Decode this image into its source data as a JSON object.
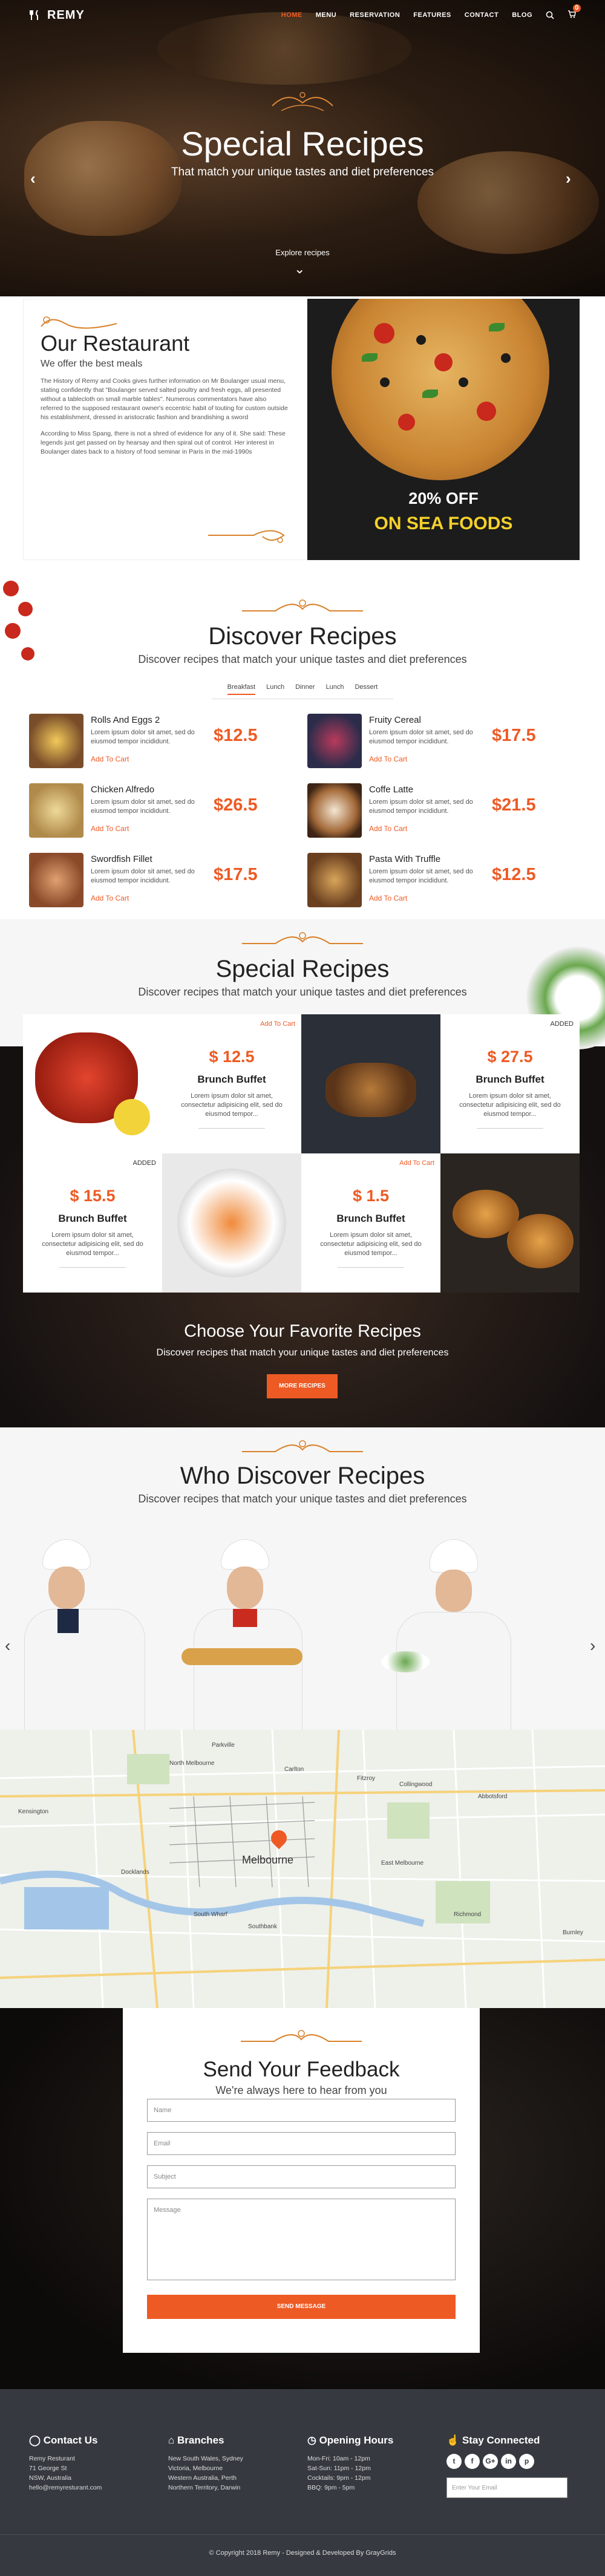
{
  "brand": "REMY",
  "nav": [
    "HOME",
    "MENU",
    "RESERVATION",
    "FEATURES",
    "CONTACT",
    "BLOG"
  ],
  "cart_count": "0",
  "accent": "#ee5a24",
  "hero": {
    "title": "Special Recipes",
    "subtitle": "That match your unique tastes and diet preferences",
    "explore": "Explore recipes"
  },
  "restaurant": {
    "title": "Our Restaurant",
    "subtitle": "We offer the best meals",
    "p1": "The History of Remy and Cooks gives further information on Mr Boulanger usual menu, stating confidently that \"Boulanger served salted poultry and fresh eggs, all presented without a tablecloth on small marble tables\". Numerous commentators have also referred to the supposed restaurant owner's eccentric habit of touting for custom outside his establishment, dressed in aristocratic fashion and brandishing a sword",
    "p2": "According to Miss Spang, there is not a shred of evidence for any of it. She said: These legends just get passed on by hearsay and then spiral out of control. Her interest in Boulanger dates back to a history of food seminar in Paris in the mid-1990s",
    "offer1": "20% OFF",
    "offer2": "ON SEA FOODS"
  },
  "discover": {
    "title": "Discover Recipes",
    "subtitle": "Discover recipes that match your unique tastes and diet preferences",
    "tabs": [
      "Breakfast",
      "Lunch",
      "Dinner",
      "Lunch",
      "Dessert"
    ],
    "items": [
      {
        "name": "Rolls And Eggs 2",
        "desc": "Lorem ipsum dolor sit amet, sed do eiusmod tempor incididunt.",
        "price": "$12.5",
        "cart": "Add To Cart"
      },
      {
        "name": "Fruity Cereal",
        "desc": "Lorem ipsum dolor sit amet, sed do eiusmod tempor incididunt.",
        "price": "$17.5",
        "cart": "Add To Cart"
      },
      {
        "name": "Chicken Alfredo",
        "desc": "Lorem ipsum dolor sit amet, sed do eiusmod tempor incididunt.",
        "price": "$26.5",
        "cart": "Add To Cart"
      },
      {
        "name": "Coffe Latte",
        "desc": "Lorem ipsum dolor sit amet, sed do eiusmod tempor incididunt.",
        "price": "$21.5",
        "cart": "Add To Cart"
      },
      {
        "name": "Swordfish Fillet",
        "desc": "Lorem ipsum dolor sit amet, sed do eiusmod tempor incididunt.",
        "price": "$17.5",
        "cart": "Add To Cart"
      },
      {
        "name": "Pasta With Truffle",
        "desc": "Lorem ipsum dolor sit amet, sed do eiusmod tempor incididunt.",
        "price": "$12.5",
        "cart": "Add To Cart"
      }
    ]
  },
  "special": {
    "title": "Special Recipes",
    "subtitle": "Discover recipes that match your unique tastes and diet preferences",
    "cards": [
      {
        "tag": "Add To Cart",
        "price": "$ 12.5",
        "name": "Brunch Buffet",
        "desc": "Lorem ipsum dolor sit amet, consectetur adipisicing elit, sed do eiusmod tempor..."
      },
      {
        "tag": "ADDED",
        "price": "$ 27.5",
        "name": "Brunch Buffet",
        "desc": "Lorem ipsum dolor sit amet, consectetur adipisicing elit, sed do eiusmod tempor..."
      },
      {
        "tag": "ADDED",
        "price": "$ 15.5",
        "name": "Brunch Buffet",
        "desc": "Lorem ipsum dolor sit amet, consectetur adipisicing elit, sed do eiusmod tempor..."
      },
      {
        "tag": "Add To Cart",
        "price": "$ 1.5",
        "name": "Brunch Buffet",
        "desc": "Lorem ipsum dolor sit amet, consectetur adipisicing elit, sed do eiusmod tempor..."
      }
    ],
    "choose_title": "Choose Your Favorite Recipes",
    "choose_sub": "Discover recipes that match your unique tastes and diet preferences",
    "more_btn": "MORE RECIPES"
  },
  "chefs": {
    "title": "Who Discover Recipes",
    "subtitle": "Discover recipes that match your unique tastes and diet preferences"
  },
  "map": {
    "city": "Melbourne",
    "labels": [
      "North Melbourne",
      "Carlton",
      "Fitzroy",
      "Collingwood",
      "Abbotsford",
      "Richmond",
      "Docklands",
      "South Wharf",
      "East Melbourne",
      "Burnley",
      "Kensington",
      "Parkville",
      "Southbank"
    ]
  },
  "feedback": {
    "title": "Send Your Feedback",
    "subtitle": "We're always here to hear from you",
    "name_ph": "Name",
    "email_ph": "Email",
    "subject_ph": "Subject",
    "message_ph": "Message",
    "send": "SEND MESSAGE"
  },
  "footer": {
    "contact_title": "Contact Us",
    "contact": [
      "Remy Resturant",
      "71 George St",
      "NSW, Australia",
      "hello@remyresturant.com"
    ],
    "branches_title": "Branches",
    "branches": [
      "New South Wales, Sydney",
      "Victoria, Melbourne",
      "Western Australia, Perth",
      "Northern Territory, Darwin"
    ],
    "hours_title": "Opening Hours",
    "hours": [
      "Mon-Fri: 10am - 12pm",
      "Sat-Sun: 11pm - 12pm",
      "Cocktails: 9pm - 12pm",
      "BBQ: 9pm - 5pm"
    ],
    "stay_title": "Stay Connected",
    "social": [
      "t",
      "f",
      "G+",
      "in",
      "p"
    ],
    "email_ph": "Enter Your Email",
    "copyright": "© Copyright 2018 Remy - Designed & Developed By GrayGrids"
  }
}
